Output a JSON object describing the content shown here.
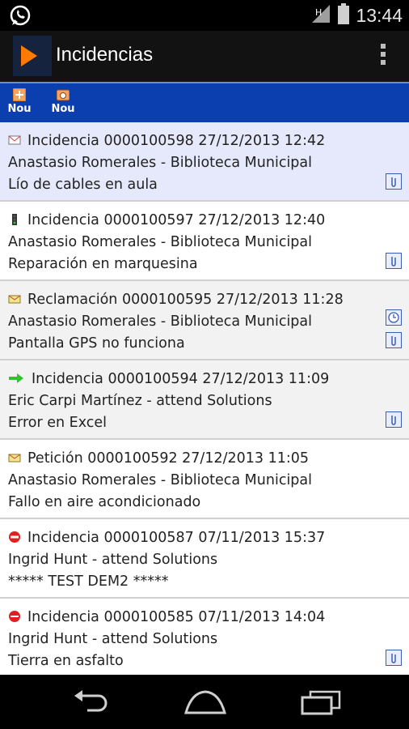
{
  "status": {
    "time": "13:44"
  },
  "app": {
    "title": "Incidencias"
  },
  "toolbar": {
    "buttons": [
      {
        "label": "Nou"
      },
      {
        "label": "Nou"
      }
    ]
  },
  "items": [
    {
      "header": "Incidencia 0000100598 27/12/2013 12:42",
      "requester": "Anastasio Romerales - Biblioteca Municipal",
      "subject": "Lío de cables en aula",
      "type_icon": "envelope-icon"
    },
    {
      "header": "Incidencia 0000100597 27/12/2013 12:40",
      "requester": "Anastasio Romerales - Biblioteca Municipal",
      "subject": "Reparación en marquesina",
      "type_icon": "traffic-light-icon"
    },
    {
      "header": "Reclamación 0000100595 27/12/2013 11:28",
      "requester": "Anastasio Romerales - Biblioteca Municipal",
      "subject": "Pantalla GPS no funciona",
      "type_icon": "envelope-open-icon"
    },
    {
      "header": "Incidencia 0000100594 27/12/2013 11:09",
      "requester": "Eric Carpi Martínez - attend Solutions",
      "subject": "Error en Excel",
      "type_icon": "arrow-right-icon"
    },
    {
      "header": "Petición 0000100592 27/12/2013 11:05",
      "requester": "Anastasio Romerales - Biblioteca Municipal",
      "subject": "Fallo en aire acondicionado",
      "type_icon": "envelope-open-icon"
    },
    {
      "header": "Incidencia 0000100587 07/11/2013 15:37",
      "requester": "Ingrid Hunt - attend Solutions",
      "subject": "***** TEST DEM2 *****",
      "type_icon": "no-entry-icon"
    },
    {
      "header": "Incidencia 0000100585 07/11/2013 14:04",
      "requester": "Ingrid Hunt - attend Solutions",
      "subject": "Tierra en asfalto",
      "type_icon": "stop-icon"
    }
  ],
  "colors": {
    "toolbar": "#0b3fb0",
    "selected_row": "#e6e9fb",
    "accent": "#ff7a00"
  }
}
